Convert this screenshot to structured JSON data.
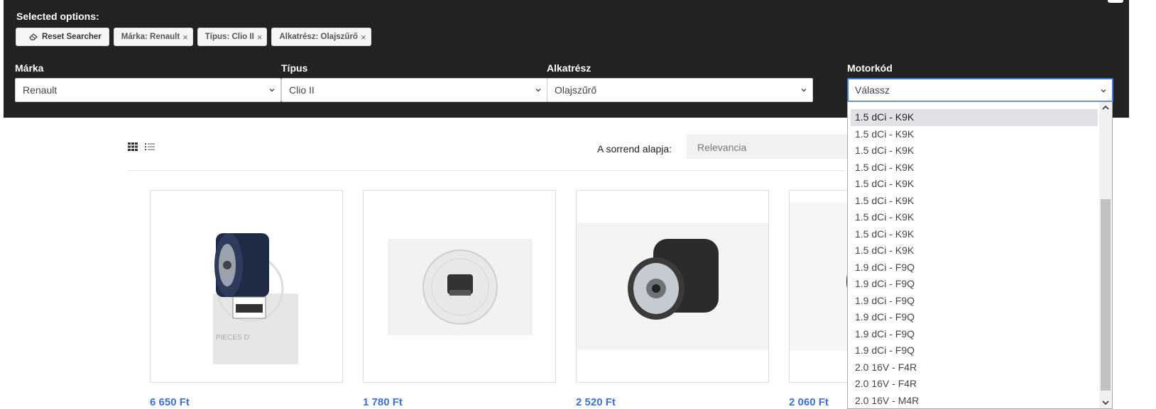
{
  "searcher": {
    "selected_title": "Selected options:",
    "reset_label": "Reset Searcher",
    "chips": [
      {
        "label": "Márka: Renault",
        "close": "×"
      },
      {
        "label": "Típus: Clio II",
        "close": "×"
      },
      {
        "label": "Alkatrész: Olajszűrő",
        "close": "×"
      }
    ],
    "fields": [
      {
        "label": "Márka",
        "value": "Renault"
      },
      {
        "label": "Típus",
        "value": "Clio II"
      },
      {
        "label": "Alkatrész",
        "value": "Olajszűrő"
      },
      {
        "label": "Motorkód",
        "value": "Válassz"
      }
    ]
  },
  "toolbar": {
    "sort_label": "A sorrend alapja:",
    "sort_value": "Relevancia"
  },
  "products": [
    {
      "price": "6 650 Ft"
    },
    {
      "price": "1 780 Ft"
    },
    {
      "price": "2 520 Ft"
    },
    {
      "price": "2 060 Ft"
    }
  ],
  "dropdown": {
    "options": [
      "1.5 dCi - K9K",
      "1.5 dCi - K9K",
      "1.5 dCi - K9K",
      "1.5 dCi - K9K",
      "1.5 dCi - K9K",
      "1.5 dCi - K9K",
      "1.5 dCi - K9K",
      "1.5 dCi - K9K",
      "1.5 dCi - K9K",
      "1.9 dCi - F9Q",
      "1.9 dCi - F9Q",
      "1.9 dCi - F9Q",
      "1.9 dCi - F9Q",
      "1.9 dCi - F9Q",
      "1.9 dCi - F9Q",
      "2.0 16V - F4R",
      "2.0 16V - F4R",
      "2.0 16V - M4R"
    ]
  },
  "colors": {
    "panel": "#222222",
    "price": "#3e6fd8",
    "focus": "#3d7bd9"
  }
}
